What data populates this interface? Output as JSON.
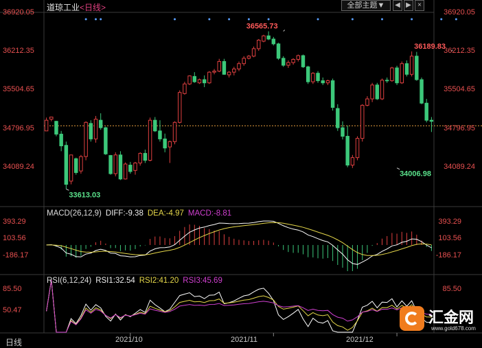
{
  "header": {
    "name": "道琼工业",
    "period": "<日线>",
    "dropdown_label": "全部主题▼",
    "nav_prev": "◀",
    "nav_next": "▶",
    "nav_close": "×"
  },
  "price_axis": {
    "labels": [
      "36920.05",
      "36212.35",
      "35504.65",
      "34796.95",
      "34089.24"
    ],
    "values": [
      36920.05,
      36212.35,
      35504.65,
      34796.95,
      34089.24
    ],
    "range": [
      33450,
      36920.05
    ],
    "last_close_line": 34796.95
  },
  "macd": {
    "title": "MACD(26,12,9)",
    "diff_label": "DIFF:-9.38",
    "dea_label": "DEA:-4.97",
    "macd_label": "MACD:-8.81",
    "axis_labels": [
      "393.29",
      "103.56",
      "-186.17"
    ],
    "axis_values": [
      393.29,
      103.56,
      -186.17
    ],
    "colors": {
      "diff": "#ffffff",
      "dea": "#e6d84a",
      "pos": "#e04040",
      "neg": "#3cc87a"
    }
  },
  "rsi": {
    "title": "RSI(6,12,24)",
    "rsi1_label": "RSI1:32.54",
    "rsi2_label": "RSI2:41.20",
    "rsi3_label": "RSI3:45.69",
    "axis_labels": [
      "85.50",
      "50.47"
    ],
    "axis_values": [
      85.5,
      50.47
    ],
    "colors": {
      "rsi1": "#ffffff",
      "rsi2": "#e6d84a",
      "rsi3": "#d040d0"
    }
  },
  "bottom": {
    "tab": "日线",
    "months": [
      "2021/10",
      "2021/11",
      "2021/12"
    ]
  },
  "logo": {
    "brand": "汇金网",
    "url": "www.gold678.com"
  },
  "chart_data": {
    "type": "candlestick",
    "colors": {
      "up": "#e04040",
      "down": "#3cc87a"
    },
    "annotations": [
      {
        "text": "33613.03",
        "index": 4,
        "value": 33613.03,
        "kind": "low"
      },
      {
        "text": "36565.73",
        "index": 48,
        "value": 36565.73,
        "kind": "high"
      },
      {
        "text": "34006.98",
        "index": 71,
        "value": 34006.98,
        "kind": "low"
      },
      {
        "text": "36189.83",
        "index": 82,
        "value": 36189.83,
        "kind": "high"
      }
    ],
    "month_tick_index": [
      17,
      46,
      71
    ],
    "ohlc": [
      [
        34700,
        34950,
        34780,
        34900
      ],
      [
        34920,
        34880,
        34960,
        34960
      ],
      [
        34880,
        34890,
        34600,
        34640
      ],
      [
        34640,
        34700,
        34320,
        34420
      ],
      [
        34430,
        34500,
        33613,
        33700
      ],
      [
        33760,
        34250,
        33700,
        34250
      ],
      [
        34180,
        34200,
        33880,
        33920
      ],
      [
        33950,
        34250,
        33900,
        34220
      ],
      [
        34220,
        34880,
        34150,
        34860
      ],
      [
        34840,
        34900,
        34500,
        34550
      ],
      [
        34550,
        34980,
        34480,
        34920
      ],
      [
        34900,
        35030,
        34720,
        34760
      ],
      [
        34760,
        34780,
        34250,
        34270
      ],
      [
        34240,
        34250,
        33880,
        33900
      ],
      [
        33900,
        34300,
        33850,
        34250
      ],
      [
        34250,
        34320,
        33780,
        33800
      ],
      [
        33800,
        34110,
        33790,
        34080
      ],
      [
        34060,
        34120,
        33900,
        33940
      ],
      [
        33960,
        34120,
        33880,
        34100
      ],
      [
        34100,
        34300,
        34050,
        34280
      ],
      [
        34280,
        34350,
        34100,
        34150
      ],
      [
        34150,
        34950,
        34130,
        34900
      ],
      [
        34900,
        34960,
        34680,
        34700
      ],
      [
        34700,
        34900,
        34500,
        34550
      ],
      [
        34550,
        34650,
        34300,
        34380
      ],
      [
        34400,
        34520,
        34100,
        34500
      ],
      [
        34500,
        34880,
        34450,
        34860
      ],
      [
        34860,
        35460,
        34840,
        35420
      ],
      [
        35400,
        35620,
        35380,
        35580
      ],
      [
        35580,
        35740,
        35560,
        35730
      ],
      [
        35720,
        35800,
        35600,
        35620
      ],
      [
        35600,
        35680,
        35580,
        35660
      ],
      [
        35660,
        35740,
        35520,
        35600
      ],
      [
        35600,
        35820,
        35580,
        35800
      ],
      [
        35800,
        35860,
        35760,
        35820
      ],
      [
        35820,
        36050,
        35800,
        36000
      ],
      [
        36000,
        36050,
        35750,
        35760
      ],
      [
        35750,
        35820,
        35700,
        35800
      ],
      [
        35800,
        35900,
        35740,
        35860
      ],
      [
        35860,
        36000,
        35820,
        35960
      ],
      [
        35960,
        36100,
        35920,
        36060
      ],
      [
        36060,
        36120,
        36040,
        36100
      ],
      [
        36100,
        36280,
        36080,
        36240
      ],
      [
        36240,
        36420,
        36200,
        36400
      ],
      [
        36380,
        36500,
        36360,
        36480
      ],
      [
        36480,
        36565,
        36400,
        36420
      ],
      [
        36420,
        36460,
        36300,
        36330
      ],
      [
        36330,
        36350,
        36030,
        36060
      ],
      [
        36060,
        36100,
        35900,
        35930
      ],
      [
        35930,
        36020,
        35880,
        35980
      ],
      [
        35980,
        36060,
        35940,
        36040
      ],
      [
        36040,
        36130,
        36000,
        36110
      ],
      [
        36110,
        36130,
        35880,
        35900
      ],
      [
        35900,
        35920,
        35580,
        35620
      ],
      [
        35620,
        35800,
        35580,
        35780
      ],
      [
        35780,
        35820,
        35600,
        35640
      ],
      [
        35640,
        35700,
        35560,
        35600
      ],
      [
        35600,
        35660,
        35560,
        35640
      ],
      [
        35640,
        35680,
        35080,
        35140
      ],
      [
        35120,
        35200,
        34700,
        34760
      ],
      [
        34760,
        34880,
        34540,
        34600
      ],
      [
        34600,
        34800,
        34020,
        34060
      ],
      [
        34060,
        34250,
        34006,
        34200
      ],
      [
        34200,
        34600,
        34150,
        34560
      ],
      [
        34560,
        35200,
        34500,
        35180
      ],
      [
        35180,
        35350,
        35160,
        35300
      ],
      [
        35300,
        35600,
        35240,
        35560
      ],
      [
        35560,
        35600,
        35280,
        35300
      ],
      [
        35300,
        35680,
        35280,
        35650
      ],
      [
        35650,
        35700,
        35600,
        35640
      ],
      [
        35640,
        35900,
        35620,
        35880
      ],
      [
        35880,
        35920,
        35560,
        35600
      ],
      [
        35600,
        36000,
        35580,
        35960
      ],
      [
        35960,
        36020,
        35720,
        35760
      ],
      [
        35760,
        36189,
        35720,
        36100
      ],
      [
        36100,
        36180,
        35640,
        35660
      ],
      [
        35660,
        35700,
        35200,
        35220
      ],
      [
        35220,
        35300,
        34860,
        34900
      ],
      [
        34900,
        34960,
        34680,
        34880
      ]
    ]
  }
}
